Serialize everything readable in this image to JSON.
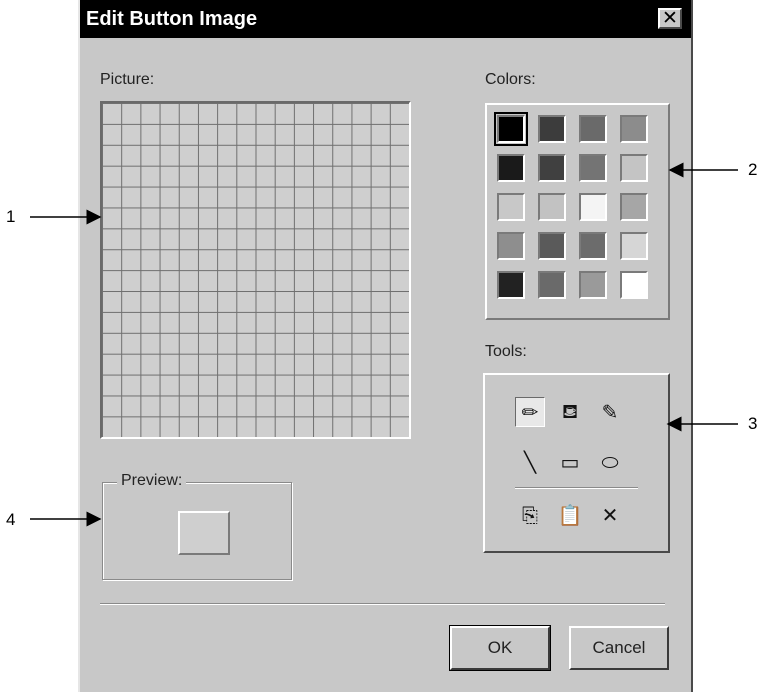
{
  "window": {
    "title": "Edit Button Image",
    "close_glyph": "✕"
  },
  "picture": {
    "label": "Picture:"
  },
  "colors": {
    "label": "Colors:",
    "swatches": [
      [
        "#000000",
        "#3c3c3c",
        "#6a6a6a",
        "#8c8c8c"
      ],
      [
        "#1a1a1a",
        "#404040",
        "#747474",
        "#c4c4c4"
      ],
      [
        "#c8c8c8",
        "#c2c2c2",
        "#f4f4f4",
        "#a6a6a6"
      ],
      [
        "#8e8e8e",
        "#5a5a5a",
        "#6c6c6c",
        "#d6d6d6"
      ],
      [
        "#222222",
        "#6a6a6a",
        "#9a9a9a",
        "#ffffff"
      ]
    ],
    "selected": [
      0,
      0
    ]
  },
  "tools": {
    "label": "Tools:",
    "items": [
      {
        "name": "pencil-tool",
        "icon": "pencil-icon",
        "glyph": "✏",
        "active": true
      },
      {
        "name": "fill-tool",
        "icon": "paint-bucket-icon",
        "glyph": "⛾",
        "active": false
      },
      {
        "name": "pick-color-tool",
        "icon": "eyedropper-icon",
        "glyph": "✎",
        "active": false
      },
      {
        "name": "line-tool",
        "icon": "line-icon",
        "glyph": "╲",
        "active": false
      },
      {
        "name": "rectangle-tool",
        "icon": "rectangle-icon",
        "glyph": "▭",
        "active": false
      },
      {
        "name": "ellipse-tool",
        "icon": "ellipse-icon",
        "glyph": "⬭",
        "active": false
      },
      {
        "name": "copy-tool",
        "icon": "copy-icon",
        "glyph": "⎘",
        "active": false
      },
      {
        "name": "paste-tool",
        "icon": "paste-icon",
        "glyph": "📋",
        "active": false
      },
      {
        "name": "clear-tool",
        "icon": "clear-icon",
        "glyph": "✕",
        "active": false
      }
    ]
  },
  "preview": {
    "label": "Preview:"
  },
  "buttons": {
    "ok": "OK",
    "cancel": "Cancel"
  },
  "callouts": [
    "1",
    "2",
    "3",
    "4"
  ]
}
